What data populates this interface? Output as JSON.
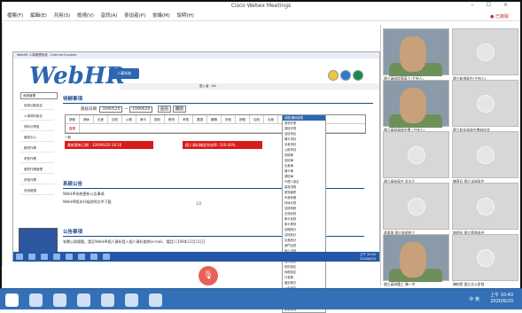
{
  "window": {
    "title": "Cisco Webex Meetings",
    "controls": "‒ ☐ ×"
  },
  "menubar": [
    "檔案(F)",
    "編輯(E)",
    "共用(S)",
    "檢視(V)",
    "音訊(A)",
    "參加者(P)",
    "會議(M)",
    "說明(H)"
  ],
  "top_right": {
    "label": "已錄製"
  },
  "browser": {
    "title": "WebHR 人事管理系統 - Internet Explorer",
    "logo": "WebHR",
    "logo_badge": "人事系統",
    "header_strip": "登入者 : NA",
    "sidebar": {
      "select_value": "系統管理",
      "items": [
        "系統功能設定",
        "人事資料設定",
        "資料分享區",
        "報表中心",
        "薪資作業",
        "考勤作業",
        "差勤作業管理",
        "其他作業",
        "系統維護"
      ]
    },
    "sections": {
      "todo_title": "待辦事項",
      "date_label": "簽核日期",
      "date_from": "1090520",
      "date_to": "1090620",
      "query_btn": "查詢",
      "close_btn": "關閉",
      "grid_headers": [
        "請假",
        "補休",
        "出差",
        "加班",
        "公假",
        "補卡",
        "調班",
        "薪資",
        "考核",
        "遷調",
        "離職",
        "其他",
        "請假",
        "加班",
        "出差",
        "費用"
      ],
      "grid_row_labels": [
        "直屬",
        "一般"
      ],
      "red1": "最新更新日期 : 109/06/20 18:10",
      "red2": "個人資料確認完成率: 100.00%",
      "news_title": "系統公告",
      "news_items": [
        "WebHR系統更新公告事項",
        "WebHR版本升級說明文件下載"
      ],
      "page": "1/2",
      "notice_title": "公告事項",
      "notice_items": [
        "有關公務電腦，請至WebHR個人資料登入個人資料查詢(e-mail、電話)"
      ],
      "notice_date": "[109年11月11日]"
    },
    "dropdown_items": [
      "請假/補休狀態",
      "差勤作業",
      "調班作業",
      "加班申請",
      "補卡申請",
      "出差申請",
      "公假申請",
      "請假單",
      "加班單",
      "出差單",
      "補卡單",
      "調班單",
      "代理人設定",
      "簽核流程",
      "差勤報表",
      "年度休假",
      "特休計算",
      "加班時數",
      "出勤紀錄",
      "刷卡紀錄",
      "刷卡異常",
      "請假統計",
      "加班統計",
      "出差統計",
      "部門出勤",
      "個人出勤",
      "差勤設定",
      "假別設定",
      "班別設定",
      "休假設定",
      "行事曆",
      "國定假日",
      "公告設定",
      "系統參數",
      "權限設定",
      "使用者管理",
      "群組管理",
      "作業紀錄"
    ],
    "taskbar_time": [
      "上午 10:40",
      "2020/6/20"
    ]
  },
  "participants": [
    {
      "name": "國立員林崇實高工(主持人)",
      "video": true
    },
    {
      "name": "國立新港高中(主持人)",
      "video": false
    },
    {
      "name": "國立員林高級中學 (主持人)",
      "video": true
    },
    {
      "name": "國立彰化高級中學林佳欣",
      "video": false
    },
    {
      "name": "國立員林高中 吳文正",
      "video": false
    },
    {
      "name": "陳彥廷 國立溪湖高中",
      "video": false
    },
    {
      "name": "蔡東榮 國立彰師附工",
      "video": false
    },
    {
      "name": "謝明宏 國立鹿港高中",
      "video": false
    },
    {
      "name": "國立員林農工 陳一中",
      "video": true
    },
    {
      "name": "陳柏毅 國立北斗家商",
      "video": false
    }
  ],
  "wintask": {
    "time": "上午 10:40",
    "date": "2020/6/20",
    "tray": "中 英"
  }
}
